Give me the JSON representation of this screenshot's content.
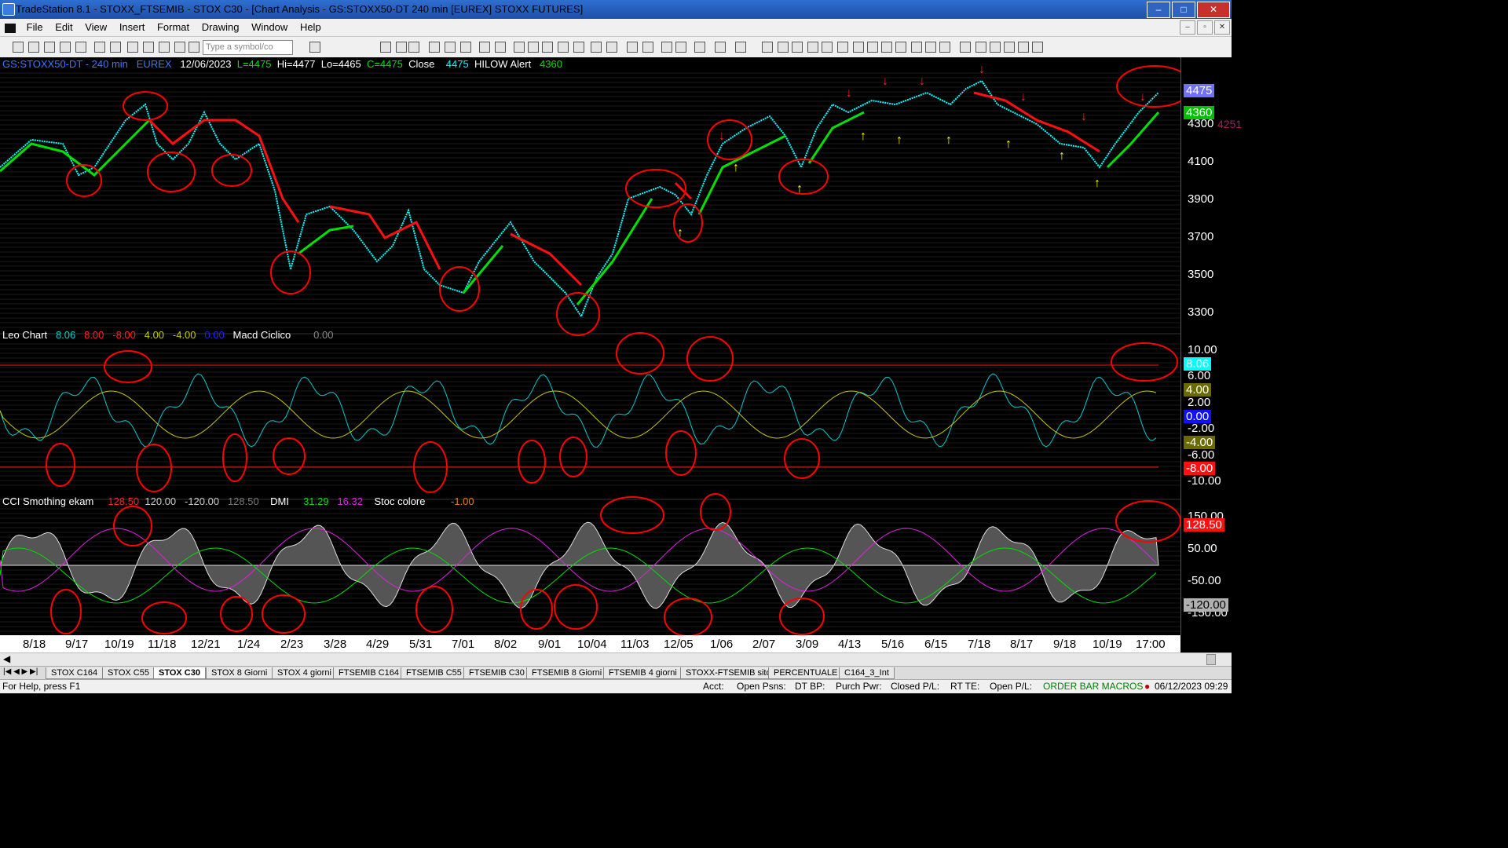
{
  "window": {
    "title": "TradeStation 8.1 - STOXX_FTSEMIB - STOX  C30 - [Chart Analysis - GS:STOXX50-DT  240 min  [EUREX] STOXX FUTURES]"
  },
  "menu": [
    "File",
    "Edit",
    "View",
    "Insert",
    "Format",
    "Drawing",
    "Window",
    "Help"
  ],
  "toolbar": {
    "symbol_placeholder": "Type a symbol/co"
  },
  "chart": {
    "header": {
      "symbol": "GS:STOXX50-DT - 240 min",
      "exchange": "EUREX",
      "date": "12/06/2023",
      "last": "L=4475",
      "hi": "Hi=4477",
      "lo": "Lo=4465",
      "close": "C=4475",
      "close_label": "Close",
      "close_val": "4475",
      "indicator": "HILOW Alert",
      "indicator_val": "4360"
    },
    "price_axis": [
      "4300",
      "4100",
      "3900",
      "3700",
      "3500",
      "3300"
    ],
    "price_labels": {
      "last": "4475",
      "hilow": "4360",
      "other": "4251"
    },
    "colors": {
      "price": "#00ffff",
      "up_line": "#00e000",
      "down_line": "#ff1010",
      "circle": "#ff0000",
      "osc": "#00cccc"
    }
  },
  "panel2": {
    "header": {
      "name": "Leo Chart",
      "v1": "8.06",
      "v2": "8.00",
      "v3": "-8.00",
      "v4": "4.00",
      "v5": "-4.00",
      "v6": "0.00",
      "name2": "Macd Ciclico",
      "v7": "0.00"
    },
    "axis": [
      "10.00",
      "6.00",
      "2.00",
      "-2.00",
      "-6.00",
      "-10.00"
    ],
    "labels": {
      "a": "8.06",
      "b": "4.00",
      "c": "0.00",
      "d": "-4.00",
      "e": "-8.00"
    }
  },
  "panel3": {
    "header": {
      "name": "CCI Smothing ekam",
      "v1": "128.50",
      "v2": "120.00",
      "v3": "-120.00",
      "v4": "128.50",
      "name2": "DMI",
      "v5": "31.29",
      "v6": "16.32",
      "name3": "Stoc colore",
      "v7": "-1.00"
    },
    "axis": [
      "150.00",
      "50.00",
      "-50.00",
      "-150.00"
    ],
    "labels": {
      "a": "128.50",
      "b": "-120.00"
    }
  },
  "dates": [
    "8/18",
    "9/17",
    "10/19",
    "11/18",
    "12/21",
    "1/24",
    "2/23",
    "3/28",
    "4/29",
    "5/31",
    "7/01",
    "8/02",
    "9/01",
    "10/04",
    "11/03",
    "12/05",
    "1/06",
    "2/07",
    "3/09",
    "4/13",
    "5/16",
    "6/15",
    "7/18",
    "8/17",
    "9/18",
    "10/19",
    "17:00"
  ],
  "tabs": [
    "STOX C164",
    "STOX C55",
    "STOX  C30",
    "STOX  8 Giorni",
    "STOX 4 giorni",
    "FTSEMIB C164",
    "FTSEMIB C55",
    "FTSEMIB C30",
    "FTSEMIB  8 Giorni",
    "FTSEMIB  4 giorni",
    "STOXX-FTSEMIB sito",
    "PERCENTUALE",
    "C164_3_Int"
  ],
  "status": {
    "help": "For Help, press F1",
    "acct": "Acct:",
    "open_psns": "Open Psns:",
    "dt_bp": "DT BP:",
    "purch_pwr": "Purch Pwr:",
    "closed_pl": "Closed P/L:",
    "rt_te": "RT TE:",
    "open_pl": "Open P/L:",
    "macros": "ORDER BAR  MACROS",
    "datetime": "06/12/2023 09:29"
  }
}
